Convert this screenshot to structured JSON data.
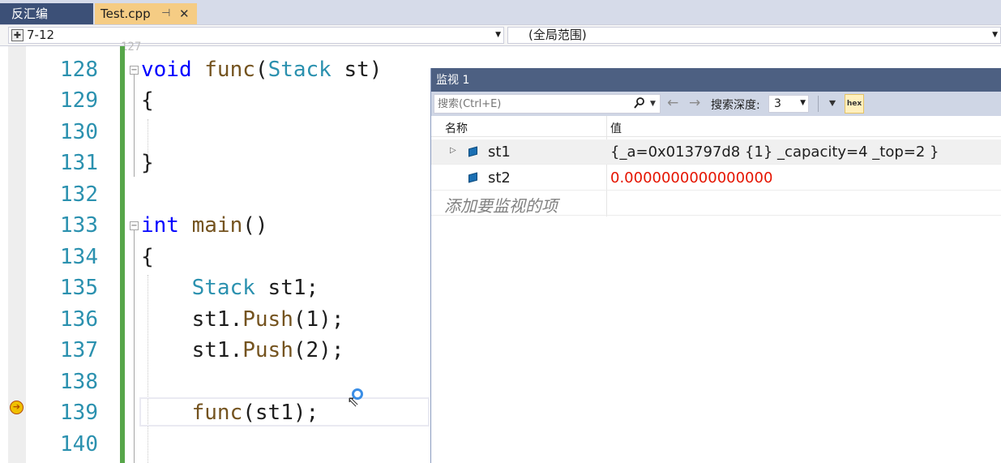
{
  "tabs": [
    {
      "label": "反汇编",
      "active": false
    },
    {
      "label": "Test.cpp",
      "active": true,
      "pin": "⊣",
      "close": "✕"
    }
  ],
  "navbar": {
    "scope_left": "7-12",
    "scope_right": "(全局范围)"
  },
  "editor": {
    "partial_top_line": "127",
    "lines": [
      {
        "num": "128"
      },
      {
        "num": "129"
      },
      {
        "num": "130"
      },
      {
        "num": "131"
      },
      {
        "num": "132"
      },
      {
        "num": "133"
      },
      {
        "num": "134"
      },
      {
        "num": "135"
      },
      {
        "num": "136"
      },
      {
        "num": "137"
      },
      {
        "num": "138"
      },
      {
        "num": "139"
      },
      {
        "num": "140"
      }
    ],
    "code": {
      "l128_kw": "void",
      "l128_fn": "func",
      "l128_p1": "(",
      "l128_ty": "Stack",
      "l128_rest": " st)",
      "l129": "{",
      "l131": "}",
      "l133_kw": "int",
      "l133_fn": "main",
      "l133_rest": "()",
      "l134": "{",
      "l135_ty": "Stack",
      "l135_rest": " st1;",
      "l136_a": "st1.",
      "l136_fn": "Push",
      "l136_b": "(1);",
      "l137_a": "st1.",
      "l137_fn": "Push",
      "l137_b": "(2);",
      "l139_fn": "func",
      "l139_b": "(st1);"
    },
    "colors": {
      "keyword": "#0000ff",
      "type": "#2b91af",
      "function": "#74531f",
      "line_number": "#2b91af",
      "change_bar": "#57a64a"
    }
  },
  "watch": {
    "title": "监视 1",
    "search_placeholder": "搜索(Ctrl+E)",
    "depth_label": "搜索深度:",
    "depth_value": "3",
    "hex_label": "hex",
    "col_name": "名称",
    "col_value": "值",
    "rows": [
      {
        "name": "st1",
        "value": "{_a=0x013797d8 {1} _capacity=4 _top=2 }",
        "expandable": true,
        "changed": false
      },
      {
        "name": "st2",
        "value": "0.0000000000000000",
        "expandable": false,
        "changed": true
      }
    ],
    "add_item": "添加要监视的项",
    "colors": {
      "title_bg": "#4d6082",
      "changed_value": "#e51400"
    }
  },
  "icons": {
    "search": "search-icon",
    "back": "arrow-left-icon",
    "forward": "arrow-right-icon",
    "filter": "filter-icon",
    "breakpoint_arrow": "current-statement-icon"
  }
}
